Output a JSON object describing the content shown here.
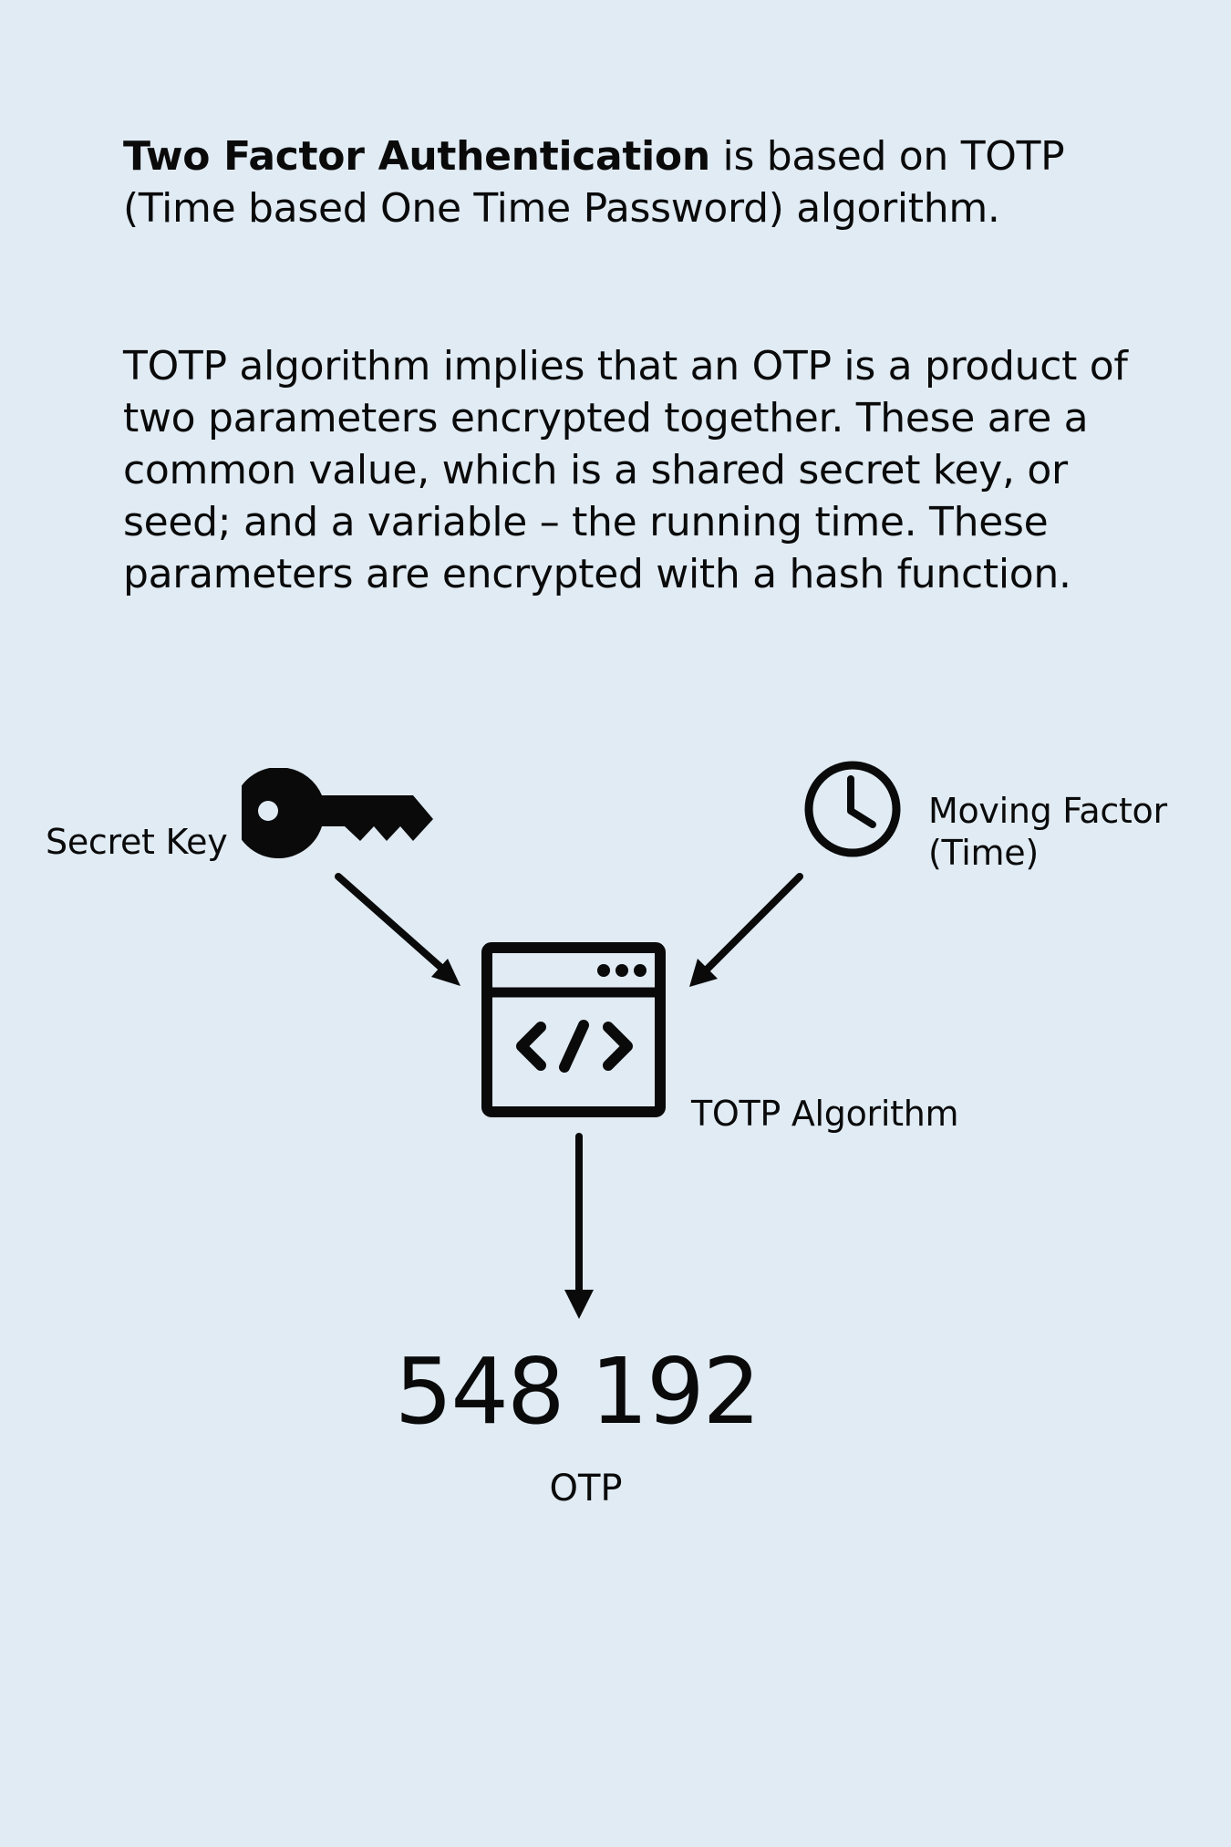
{
  "intro": {
    "bold": "Two Factor Authentication",
    "rest": " is based on TOTP (Time based One Time Password) algorithm."
  },
  "description": "TOTP algorithm implies that an OTP is a product of two parameters encrypted together. These are a common value, which is a shared secret key, or seed; and a variable – the running time. These parameters are encrypted with a hash function.",
  "diagram": {
    "secret_key_label": "Secret Key",
    "moving_factor_line1": "Moving Factor",
    "moving_factor_line2": "(Time)",
    "algorithm_label": "TOTP Algorithm",
    "otp_value": "548 192",
    "otp_label": "OTP",
    "icons": [
      "key-icon",
      "clock-icon",
      "code-window-icon"
    ]
  }
}
